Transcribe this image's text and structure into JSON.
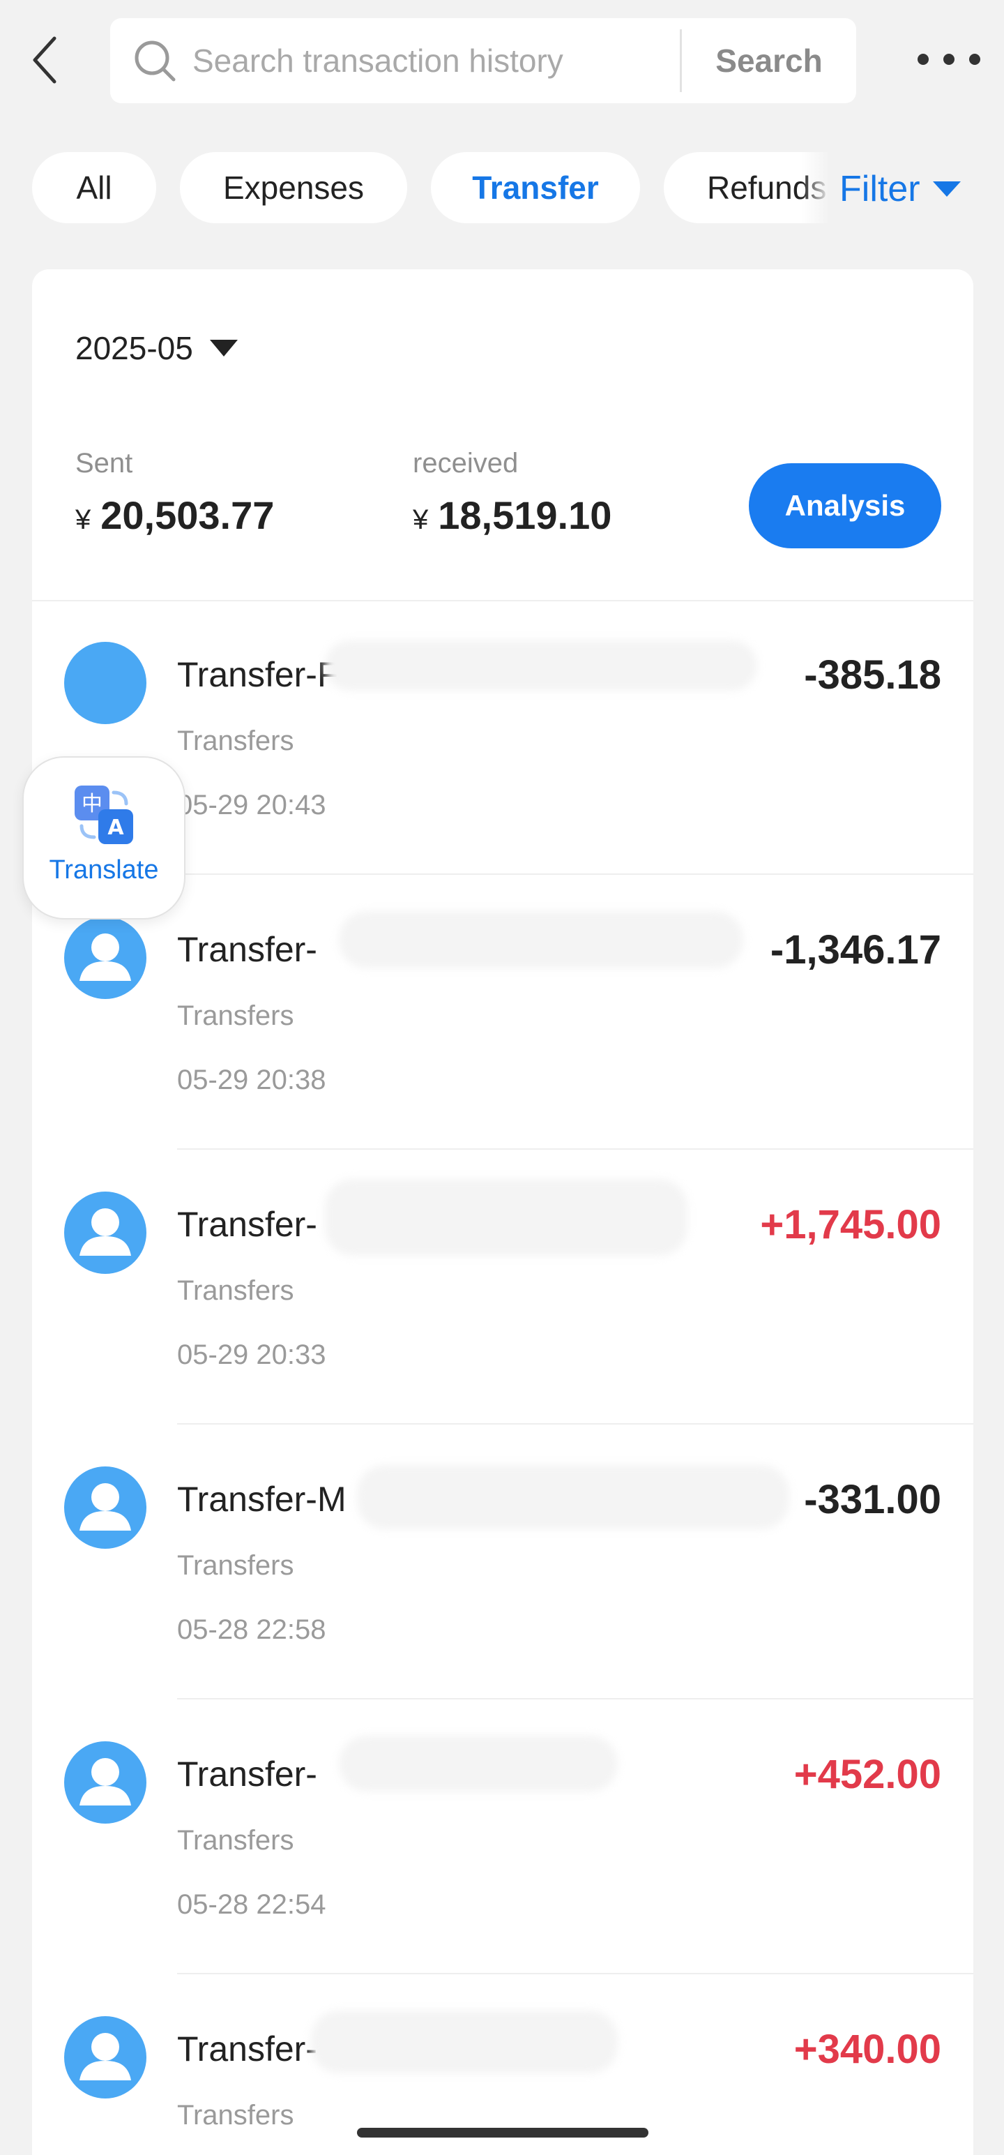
{
  "header": {
    "back_icon": "chevron-left-icon",
    "search_placeholder": "Search transaction history",
    "search_button_label": "Search",
    "more_icon": "more-horizontal-icon"
  },
  "tabs": [
    {
      "label": "All",
      "active": false
    },
    {
      "label": "Expenses",
      "active": false
    },
    {
      "label": "Transfer",
      "active": true
    },
    {
      "label": "Refunds",
      "active": false
    }
  ],
  "filter": {
    "label": "Filter",
    "icon": "caret-down-icon"
  },
  "summary": {
    "month": "2025-05",
    "sent_label": "Sent",
    "sent_currency": "¥",
    "sent_amount": "20,503.77",
    "received_label": "received",
    "received_currency": "¥",
    "received_amount": "18,519.10",
    "analysis_label": "Analysis"
  },
  "transactions": [
    {
      "title": "Transfer-F",
      "category": "Transfers",
      "time": "05-29 20:43",
      "amount": "-385.18",
      "direction": "out"
    },
    {
      "title": "Transfer-",
      "category": "Transfers",
      "time": "05-29 20:38",
      "amount": "-1,346.17",
      "direction": "out"
    },
    {
      "title": "Transfer-",
      "category": "Transfers",
      "time": "05-29 20:33",
      "amount": "+1,745.00",
      "direction": "in"
    },
    {
      "title": "Transfer-M",
      "category": "Transfers",
      "time": "05-28 22:58",
      "amount": "-331.00",
      "direction": "out"
    },
    {
      "title": "Transfer-",
      "category": "Transfers",
      "time": "05-28 22:54",
      "amount": "+452.00",
      "direction": "in"
    },
    {
      "title": "Transfer-",
      "category": "Transfers",
      "time": "",
      "amount": "+340.00",
      "direction": "in"
    }
  ],
  "translate": {
    "label": "Translate",
    "icon": "translate-icon"
  },
  "colors": {
    "accent": "#1677e6",
    "positive_amount": "#e23a4a",
    "avatar": "#4aa8f4",
    "page_bg": "#f2f2f2"
  }
}
